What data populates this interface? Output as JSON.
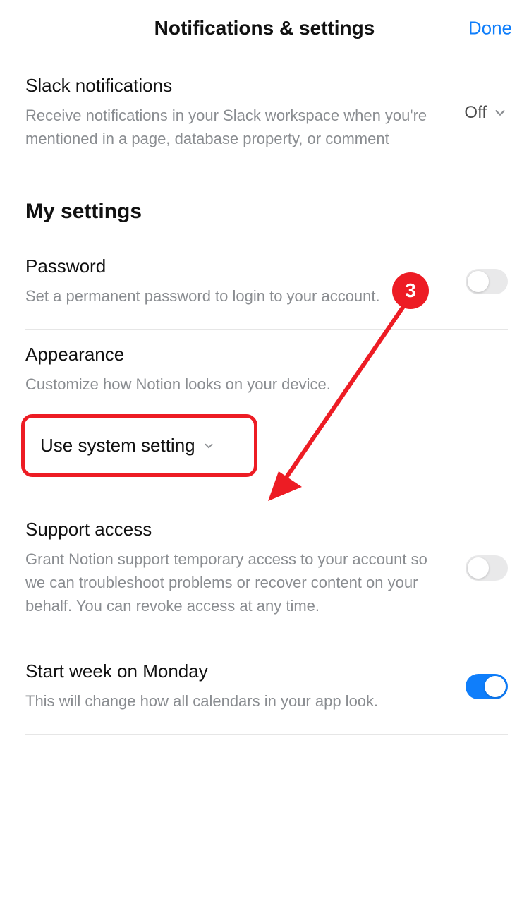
{
  "header": {
    "title": "Notifications & settings",
    "done": "Done"
  },
  "slack": {
    "label": "Slack notifications",
    "desc": "Receive notifications in your Slack workspace when you're mentioned in a page, database property, or comment",
    "value": "Off"
  },
  "section_my_settings": "My settings",
  "password": {
    "label": "Password",
    "desc": "Set a permanent password to login to your account."
  },
  "appearance": {
    "label": "Appearance",
    "desc": "Customize how Notion looks on your device.",
    "value": "Use system setting"
  },
  "support": {
    "label": "Support access",
    "desc": "Grant Notion support temporary access to your account so we can troubleshoot problems or recover content on your behalf. You can revoke access at any time."
  },
  "startweek": {
    "label": "Start week on Monday",
    "desc": "This will change how all calendars in your app look."
  },
  "annotation": {
    "badge": "3"
  }
}
